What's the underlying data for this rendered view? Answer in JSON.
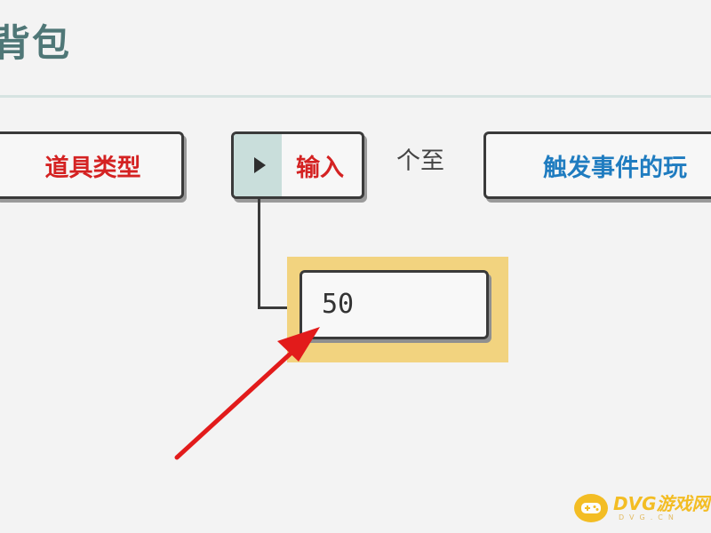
{
  "header": {
    "title": "背包"
  },
  "blocks": {
    "item_type_label": "道具类型",
    "input_label": "输入",
    "between_text": "个至",
    "trigger_label": "触发事件的玩"
  },
  "value_input": {
    "value": "50"
  },
  "colors": {
    "label_red": "#d42222",
    "label_blue": "#1f7cc0",
    "title_teal": "#4f7777",
    "highlight": "#f2d37f",
    "arrow": "#e21b1b",
    "toggle_bg": "#c9dedb"
  },
  "watermark": {
    "text": "DVG游戏网",
    "subtext": "DVG.CN",
    "icon": "gamepad-icon"
  }
}
